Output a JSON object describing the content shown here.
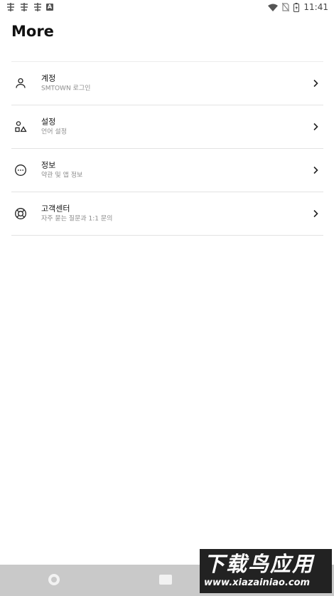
{
  "status_bar": {
    "time": "11:41",
    "notification_icons": [
      "carrier-icon",
      "carrier-icon",
      "carrier-icon",
      "a-badge-icon"
    ],
    "system_icons": [
      "wifi-icon",
      "no-sim-icon",
      "battery-icon"
    ]
  },
  "page": {
    "title": "More"
  },
  "menu": {
    "items": [
      {
        "icon": "person-icon",
        "label": "계정",
        "sublabel": "SMTOWN 로그인"
      },
      {
        "icon": "shapes-icon",
        "label": "설정",
        "sublabel": "언어 설정"
      },
      {
        "icon": "more-circle-icon",
        "label": "정보",
        "sublabel": "약관 및 앱 정보"
      },
      {
        "icon": "lifebuoy-icon",
        "label": "고객센터",
        "sublabel": "자주 묻는 질문과 1:1 문의"
      }
    ]
  },
  "watermark": {
    "title": "下载鸟应用",
    "url": "www.xiazainiao.com"
  },
  "colors": {
    "divider": "#e3e3e3",
    "subtitle": "#8c8c8c",
    "nav_bar": "#c9c9c9"
  }
}
